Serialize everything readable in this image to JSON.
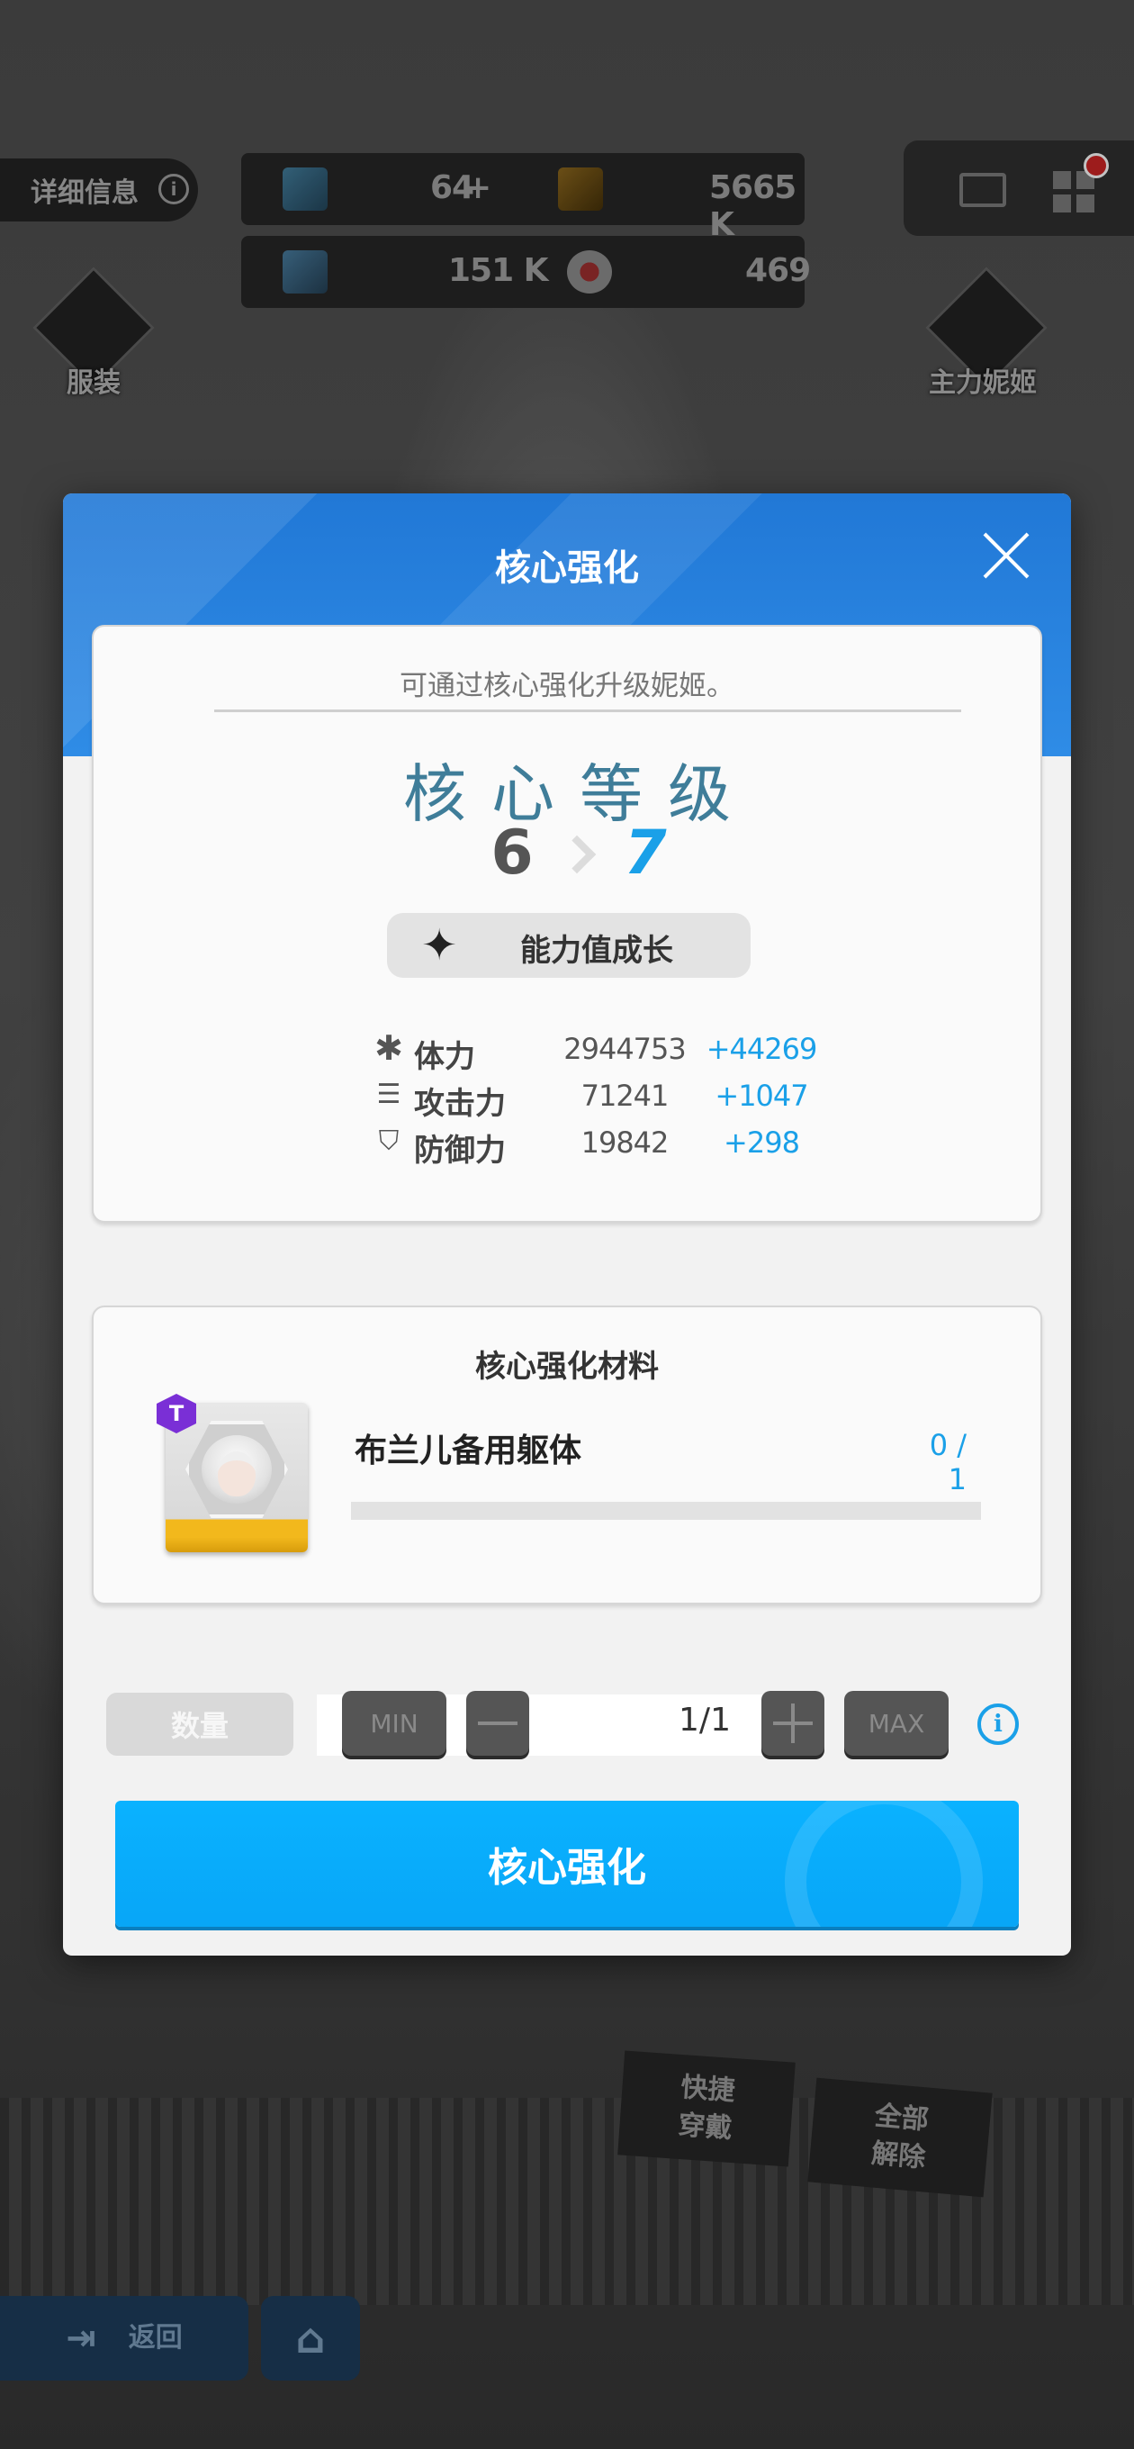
{
  "background": {
    "info_button": "详细信息",
    "info_icon": "i",
    "resources": {
      "gems": "64",
      "gems_plus": "+",
      "credits": "5665 K",
      "battle_data": "151 K",
      "core_dust": "469"
    },
    "costume_label": "服装",
    "main_nikke_label": "主力妮姬",
    "quick_equip_label": "快捷\n穿戴",
    "unequip_all_label": "全部\n解除",
    "back_label": "返回"
  },
  "modal": {
    "title": "核心强化",
    "description": "可通过核心强化升级妮姬。",
    "level_title": "核心等级",
    "level_from": "6",
    "level_to": "7",
    "growth_label": "能力值成长",
    "stats": [
      {
        "icon": "hp-icon",
        "name": "体力",
        "value": "2944753",
        "increase": "+44269"
      },
      {
        "icon": "attack-icon",
        "name": "攻击力",
        "value": "71241",
        "increase": "+1047"
      },
      {
        "icon": "defense-icon",
        "name": "防御力",
        "value": "19842",
        "increase": "+298"
      }
    ],
    "materials": {
      "title": "核心强化材料",
      "item_name": "布兰儿备用躯体",
      "item_badge": "T",
      "count": "0 / 1",
      "progress": 0
    },
    "quantity": {
      "label": "数量",
      "min_label": "MIN",
      "max_label": "MAX",
      "value": "1/1"
    },
    "confirm_button": "核心强化"
  },
  "colors": {
    "header_blue": "#2178d6",
    "accent_blue": "#1aa0e8",
    "button_blue": "#0ab2ff",
    "badge_purple": "#7a2fd6"
  }
}
